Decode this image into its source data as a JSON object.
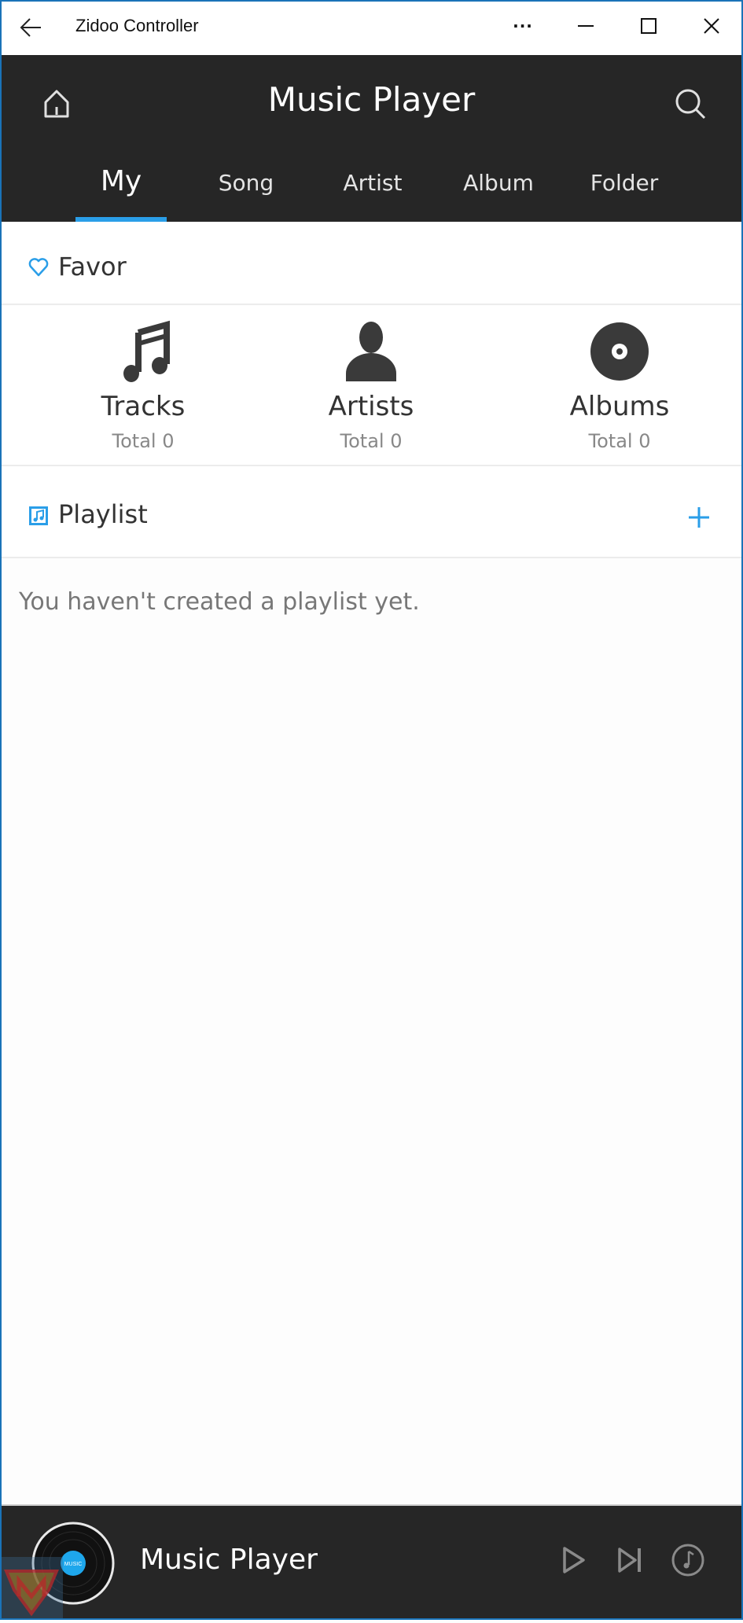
{
  "window": {
    "title": "Zidoo Controller",
    "controls": [
      "back-icon",
      "more-icon",
      "minimize-icon",
      "maximize-icon",
      "close-icon"
    ],
    "more_glyph": "···"
  },
  "header": {
    "title": "Music Player",
    "left_icon": "home-icon",
    "right_icon": "search-icon",
    "tabs": [
      {
        "label": "My",
        "active": true
      },
      {
        "label": "Song",
        "active": false
      },
      {
        "label": "Artist",
        "active": false
      },
      {
        "label": "Album",
        "active": false
      },
      {
        "label": "Folder",
        "active": false
      }
    ]
  },
  "favor": {
    "label": "Favor",
    "icon": "heart-icon",
    "items": [
      {
        "name": "Tracks",
        "total": "Total 0",
        "icon": "music-note-icon"
      },
      {
        "name": "Artists",
        "total": "Total 0",
        "icon": "person-icon"
      },
      {
        "name": "Albums",
        "total": "Total 0",
        "icon": "disc-icon"
      }
    ]
  },
  "playlist": {
    "label": "Playlist",
    "icon": "playlist-icon",
    "add_icon": "plus-icon",
    "empty_text": "You haven't created a playlist yet."
  },
  "player": {
    "title": "Music Player",
    "disc_label": "MUSIC",
    "controls": [
      "play-icon",
      "next-icon",
      "music-circle-icon"
    ]
  },
  "colors": {
    "accent": "#2a9ee8",
    "header_bg": "#262626",
    "window_border": "#1a73b8"
  }
}
